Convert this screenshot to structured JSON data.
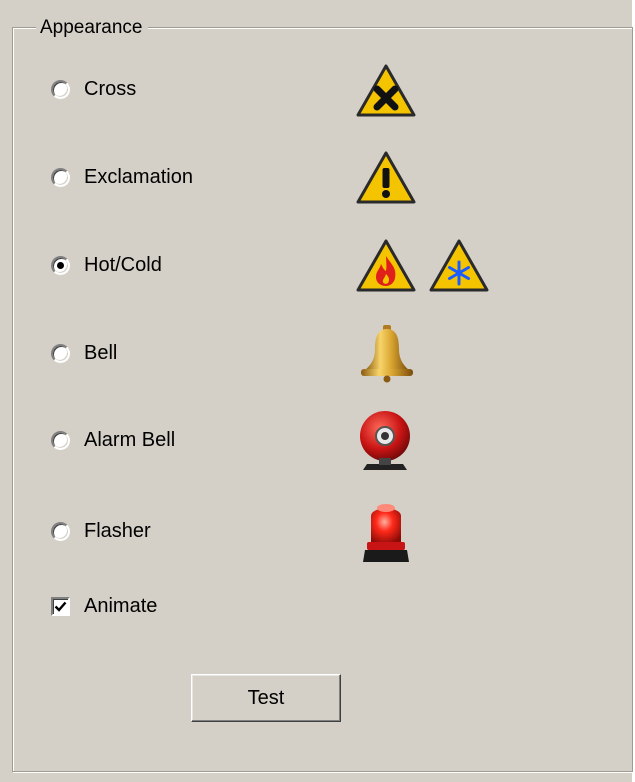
{
  "group": {
    "title": "Appearance"
  },
  "options": [
    {
      "label": "Cross",
      "selected": false,
      "icon": "hazard-cross-icon"
    },
    {
      "label": "Exclamation",
      "selected": false,
      "icon": "hazard-exclamation-icon"
    },
    {
      "label": "Hot/Cold",
      "selected": true,
      "icon": "hazard-hot-cold-icon"
    },
    {
      "label": "Bell",
      "selected": false,
      "icon": "bell-icon"
    },
    {
      "label": "Alarm Bell",
      "selected": false,
      "icon": "alarm-bell-icon"
    },
    {
      "label": "Flasher",
      "selected": false,
      "icon": "flasher-icon"
    }
  ],
  "animate": {
    "label": "Animate",
    "checked": true
  },
  "test_button": {
    "label": "Test"
  },
  "colors": {
    "background": "#d4d0c8",
    "hazard_yellow": "#f4c400",
    "flame_red": "#e0201a",
    "snow_blue": "#1a5cff",
    "bell_gold": "#d9a531",
    "alarm_red": "#c81414"
  }
}
